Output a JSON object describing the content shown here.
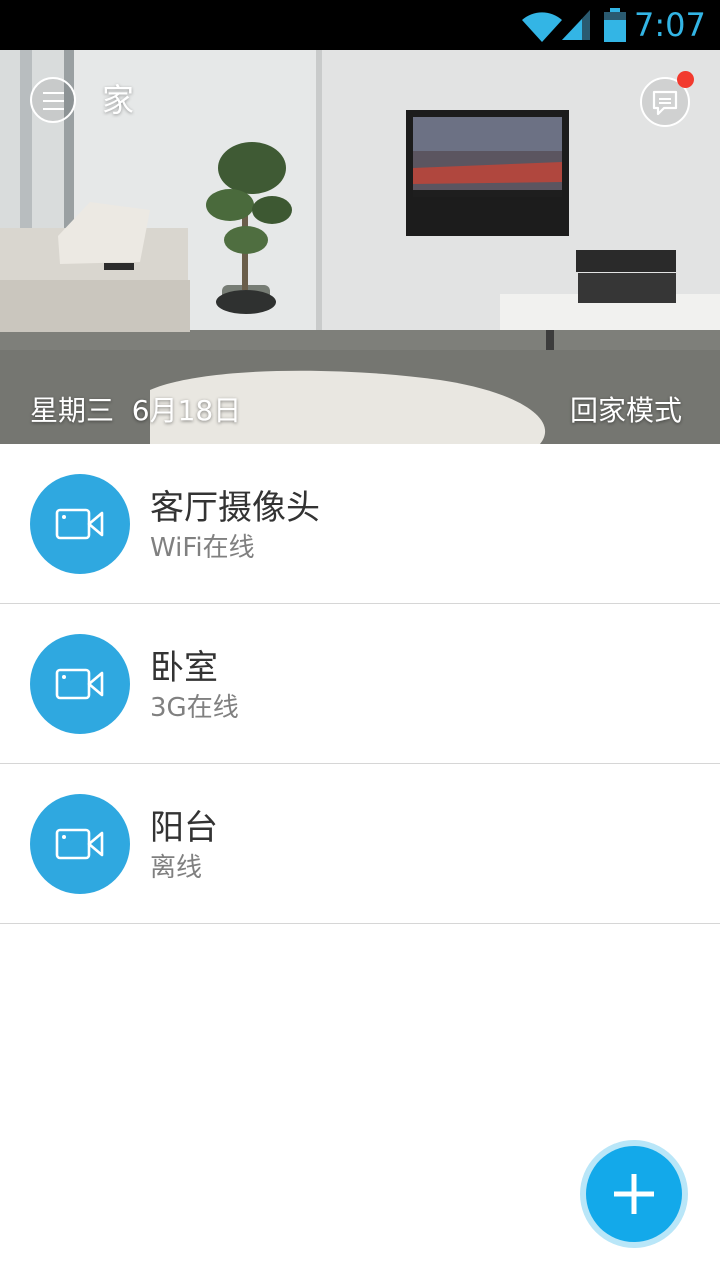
{
  "status_bar": {
    "time": "7:07",
    "accent_color": "#33b5e5"
  },
  "header": {
    "title": "家",
    "menu_icon": "hamburger-menu-icon",
    "message_icon": "message-bubble-icon",
    "has_unread_badge": true,
    "date": "星期三  6月18日",
    "mode": "回家模式"
  },
  "devices": [
    {
      "name": "客厅摄像头",
      "status": "WiFi在线",
      "icon": "video-camera-icon"
    },
    {
      "name": "卧室",
      "status": "3G在线",
      "icon": "video-camera-icon"
    },
    {
      "name": "阳台",
      "status": "离线",
      "icon": "video-camera-icon"
    }
  ],
  "fab": {
    "icon": "plus-icon",
    "color": "#13a9ea"
  },
  "colors": {
    "device_icon_bg": "#2fa8e0",
    "badge": "#f23a2e"
  }
}
